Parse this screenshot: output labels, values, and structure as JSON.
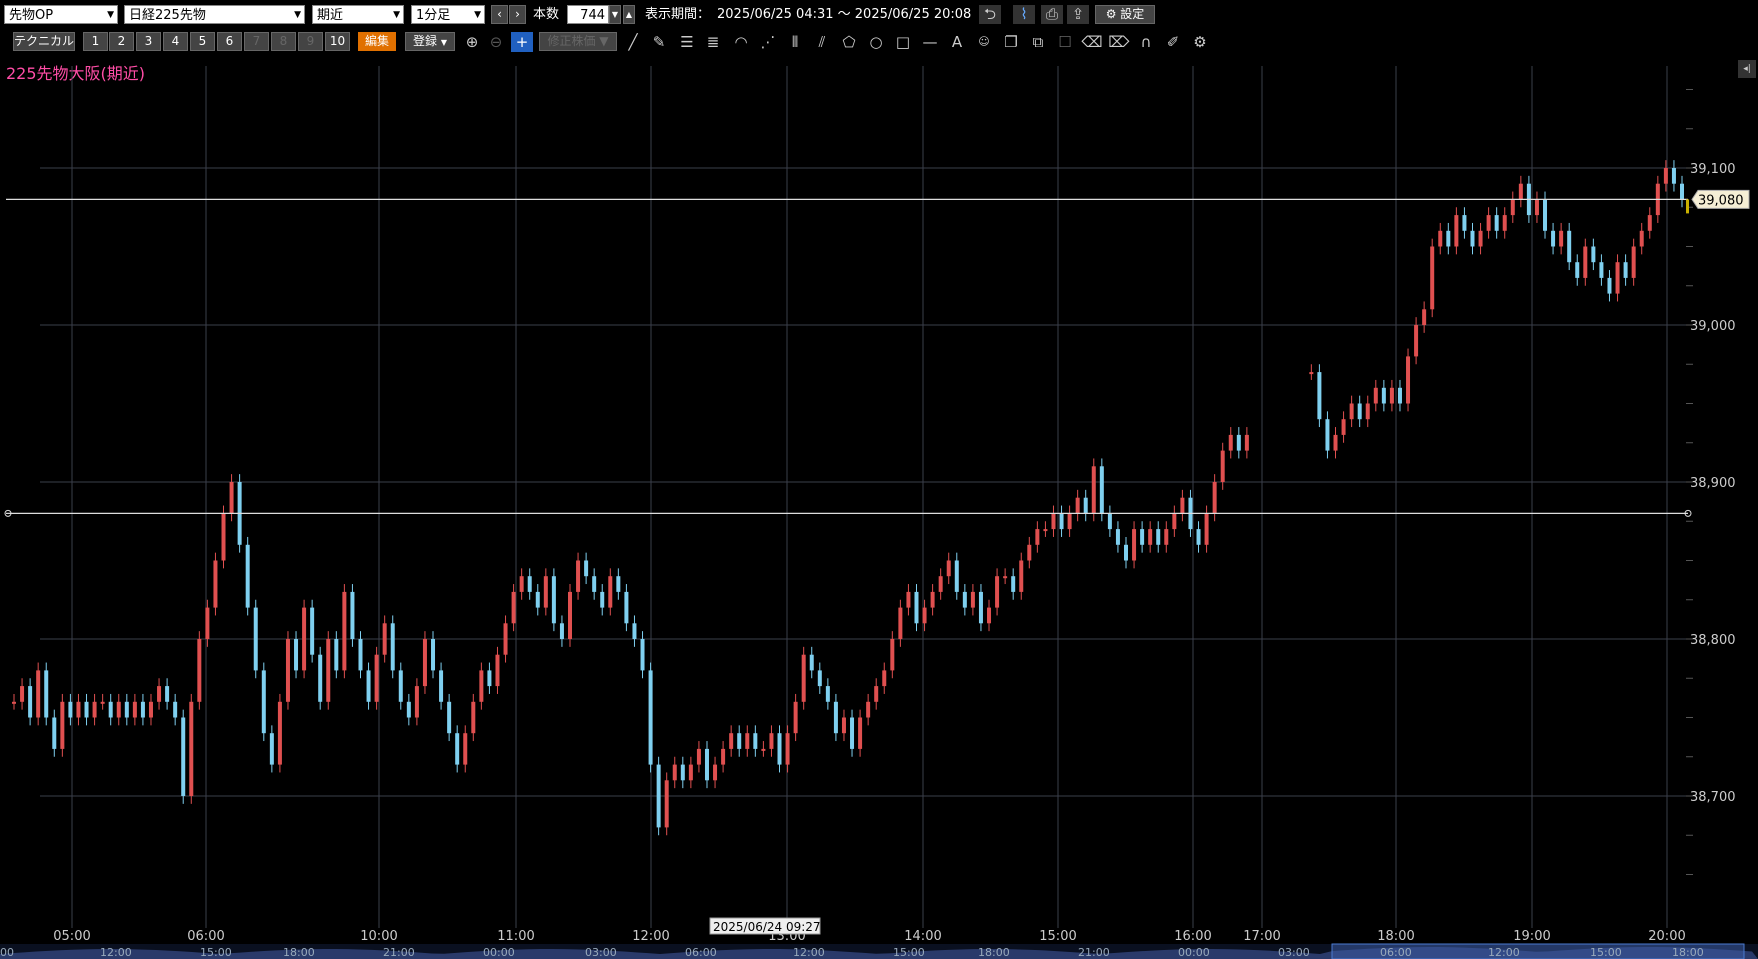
{
  "toolbar": {
    "market_select": "先物OP",
    "product_select": "日経225先物",
    "month_select": "期近",
    "interval_select": "1分足",
    "prev_label": "‹",
    "next_label": "›",
    "bars_label": "本数",
    "bars_value": "744",
    "period_label": "表示期間：",
    "period_value": "2025/06/25 04:31 ～ 2025/06/25 20:08",
    "settings_label": "設定"
  },
  "toolbar2": {
    "technical_label": "テクニカル",
    "slots": [
      "1",
      "2",
      "3",
      "4",
      "5",
      "6",
      "7",
      "8",
      "9",
      "10"
    ],
    "edit_label": "編集",
    "register_label": "登録",
    "correct_label": "修正株価"
  },
  "chart_title": "225先物大阪(期近)",
  "price_tag": "39,080",
  "cursor_date": "2025/06/24 09:27",
  "chart_data": {
    "type": "candlestick",
    "y_ticks": [
      "39,100",
      "39,000",
      "38,900",
      "38,800",
      "38,700"
    ],
    "y_tick_values": [
      39100,
      39000,
      38900,
      38800,
      38700
    ],
    "x_labels": [
      "05:00",
      "06:00",
      "10:00",
      "11:00",
      "12:00",
      "13:00",
      "14:00",
      "15:00",
      "16:00",
      "17:00",
      "18:00",
      "19:00",
      "20:00"
    ],
    "nav_labels": [
      "00",
      "12:00",
      "15:00",
      "18:00",
      "21:00",
      "00:00",
      "03:00",
      "06:00",
      "12:00",
      "15:00",
      "18:00",
      "21:00",
      "00:00",
      "03:00",
      "06:00",
      "12:00",
      "15:00",
      "18:00"
    ],
    "horizontal_lines": [
      39080,
      38880
    ],
    "last_price": 39080,
    "up_color": "#e05050",
    "down_color": "#7fd0f0",
    "path": [
      38760,
      38770,
      38750,
      38780,
      38750,
      38730,
      38760,
      38750,
      38760,
      38750,
      38760,
      38760,
      38750,
      38760,
      38750,
      38760,
      38750,
      38760,
      38770,
      38760,
      38750,
      38700,
      38760,
      38800,
      38820,
      38850,
      38880,
      38900,
      38860,
      38820,
      38780,
      38740,
      38720,
      38760,
      38800,
      38780,
      38820,
      38790,
      38760,
      38800,
      38780,
      38830,
      38800,
      38780,
      38760,
      38790,
      38810,
      38780,
      38760,
      38750,
      38770,
      38800,
      38780,
      38760,
      38740,
      38720,
      38740,
      38760,
      38780,
      38770,
      38790,
      38810,
      38830,
      38840,
      38830,
      38820,
      38840,
      38810,
      38800,
      38830,
      38850,
      38840,
      38830,
      38820,
      38840,
      38830,
      38810,
      38800,
      38780,
      38720,
      38680,
      38710,
      38720,
      38710,
      38720,
      38730,
      38710,
      38720,
      38730,
      38740,
      38730,
      38740,
      38730,
      38730,
      38740,
      38720,
      38740,
      38760,
      38790,
      38780,
      38770,
      38760,
      38740,
      38750,
      38730,
      38750,
      38760,
      38770,
      38780,
      38800,
      38820,
      38830,
      38810,
      38820,
      38830,
      38840,
      38850,
      38830,
      38820,
      38830,
      38810,
      38820,
      38840,
      38840,
      38830,
      38850,
      38860,
      38870,
      38870,
      38880,
      38870,
      38880,
      38890,
      38880,
      38910,
      38880,
      38870,
      38860,
      38850,
      38870,
      38860,
      38870,
      38860,
      38870,
      38880,
      38890,
      38870,
      38860,
      38880,
      38900,
      38920,
      38930,
      38920,
      38930,
      null,
      null,
      null,
      null,
      null,
      null,
      null,
      38970,
      38940,
      38920,
      38930,
      38940,
      38950,
      38940,
      38950,
      38960,
      38950,
      38960,
      38950,
      38980,
      39000,
      39010,
      39050,
      39060,
      39050,
      39070,
      39060,
      39050,
      39060,
      39070,
      39060,
      39070,
      39080,
      39090,
      39070,
      39080,
      39060,
      39050,
      39060,
      39040,
      39030,
      39050,
      39040,
      39030,
      39020,
      39040,
      39030,
      39050,
      39060,
      39070,
      39090,
      39100,
      39090,
      39080
    ]
  }
}
